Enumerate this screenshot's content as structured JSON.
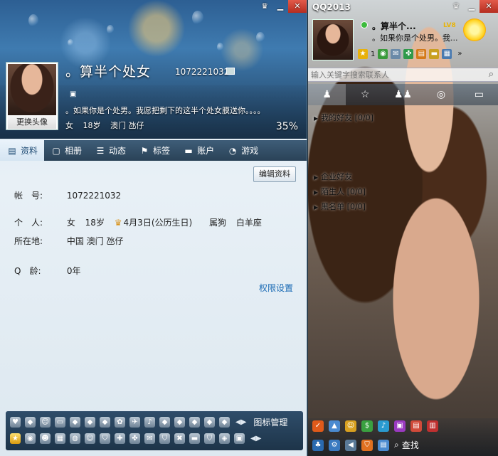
{
  "profile": {
    "nickname": "。算半个处女",
    "qq_number": "1072221032",
    "signature": "。如果你是个处男。我愿把剩下的这半个处女膜送你。。。。",
    "gender": "女",
    "age": "18岁",
    "location_short": "澳门 氹仔",
    "completion": "35%",
    "change_avatar_label": "更换头像",
    "edit_label": "编辑资料",
    "tabs": [
      {
        "label": "资料",
        "icon": "id-card-icon"
      },
      {
        "label": "相册",
        "icon": "photo-icon"
      },
      {
        "label": "动态",
        "icon": "list-icon"
      },
      {
        "label": "标签",
        "icon": "bookmark-icon"
      },
      {
        "label": "账户",
        "icon": "wallet-icon"
      },
      {
        "label": "游戏",
        "icon": "game-icon"
      }
    ],
    "info": {
      "account_label": "帐　号:",
      "account_value": "1072221032",
      "personal_label": "个　人:",
      "personal_gender": "女",
      "personal_age": "18岁",
      "birthday": "4月3日(公历生日)",
      "zodiac": "属狗",
      "constellation": "白羊座",
      "location_label": "所在地:",
      "location_value": "中国 澳门 氹仔",
      "qage_label": "Q　龄:",
      "qage_value": "0年"
    },
    "permission_link": "权限设置",
    "icon_manage_label": "图标管理"
  },
  "main": {
    "title": "QQ2013",
    "nickname": "。算半个...",
    "vip": "LV8",
    "signature": "。如果你是个处男。我...",
    "level_count": "1",
    "search_placeholder": "输入关键字搜索联系人",
    "groups": [
      {
        "label": "我的好友 [0/0]",
        "expanded": false
      },
      {
        "label": "企业好友",
        "expanded": false
      },
      {
        "label": "陌生人 [0/0]",
        "expanded": false
      },
      {
        "label": "黑名单 [0/0]",
        "expanded": false
      }
    ],
    "find_label": "查找"
  },
  "colors": {
    "tab_active": "#d5e5f2",
    "link": "#1b6bb5",
    "status_online": "#3dbb3d"
  }
}
